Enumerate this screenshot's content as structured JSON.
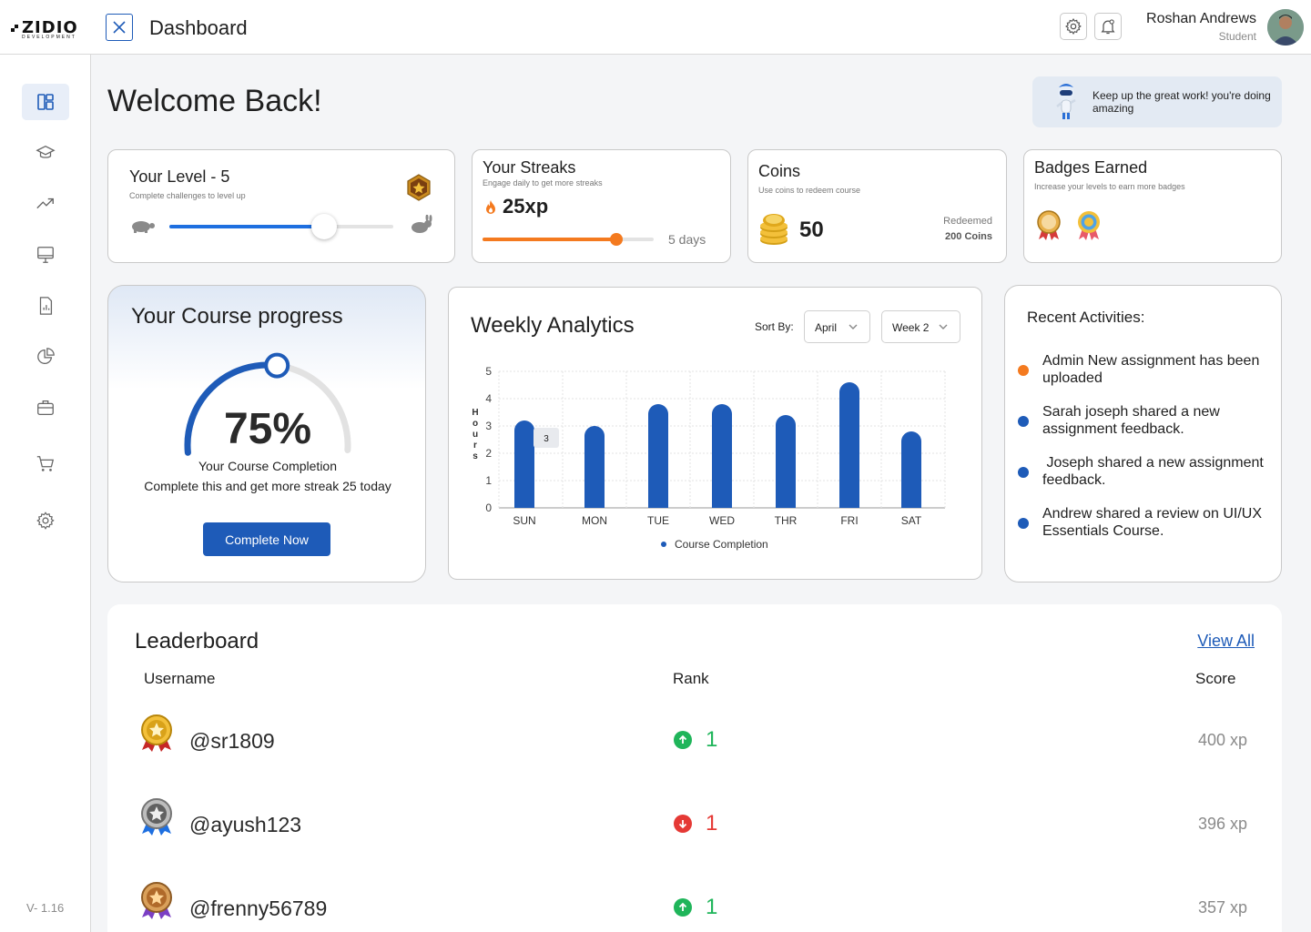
{
  "header": {
    "logo_text": "ZIDIO",
    "logo_sub": "DEVELOPMENT",
    "title": "Dashboard",
    "user_name": "Roshan Andrews",
    "user_role": "Student"
  },
  "sidebar": {
    "items": [
      "dashboard",
      "courses",
      "analytics",
      "classroom",
      "reports",
      "statistics",
      "portfolio",
      "cart",
      "settings"
    ],
    "version": "V- 1.16"
  },
  "welcome": {
    "title": "Welcome Back!",
    "toast": "Keep up the great work! you're doing amazing"
  },
  "level": {
    "title": "Your Level - 5",
    "subtitle": "Complete challenges to level up",
    "progress": 0.69
  },
  "streaks": {
    "title": "Your Streaks",
    "subtitle": "Engage daily to get more streaks",
    "xp": "25xp",
    "days": "5 days",
    "progress": 0.78
  },
  "coins": {
    "title": "Coins",
    "subtitle": "Use coins to redeem course",
    "value": "50",
    "redeemed_label": "Redeemed",
    "redeemed_value": "200 Coins"
  },
  "badges": {
    "title": "Badges Earned",
    "subtitle": "Increase your levels to earn more badges"
  },
  "course_progress": {
    "title": "Your Course progress",
    "percent": "75%",
    "value": 0.75,
    "label": "Your Course Completion",
    "description": "Complete this and get more streak 25 today",
    "button": "Complete Now"
  },
  "weekly": {
    "title": "Weekly Analytics",
    "sort_label": "Sort By:",
    "month": "April",
    "week": "Week 2",
    "y_label": "Hours",
    "legend": "Course Completion",
    "tooltip": "3"
  },
  "chart_data": {
    "type": "bar",
    "categories": [
      "SUN",
      "MON",
      "TUE",
      "WED",
      "THR",
      "FRI",
      "SAT"
    ],
    "series": [
      {
        "name": "Course Completion",
        "values": [
          3.2,
          3.0,
          3.8,
          3.8,
          3.4,
          4.6,
          2.8
        ]
      }
    ],
    "ylabel": "Hours",
    "ylim": [
      0,
      5
    ],
    "yticks": [
      0,
      1,
      2,
      3,
      4,
      5
    ],
    "grid": true,
    "legend": "bottom",
    "bar_color": "#1e5bb8"
  },
  "recent": {
    "title": "Recent Activities:",
    "items": [
      {
        "text": "Admin New assignment has been uploaded",
        "color": "#f47a1f"
      },
      {
        "text": "Sarah joseph shared a new assignment feedback.",
        "color": "#1e5bb8"
      },
      {
        "text": " Joseph shared a new assignment feedback.",
        "color": "#1e5bb8"
      },
      {
        "text": "Andrew shared a review on UI/UX Essentials Course.",
        "color": "#1e5bb8"
      }
    ]
  },
  "leaderboard": {
    "title": "Leaderboard",
    "view_all": "View All",
    "col_user": "Username",
    "col_rank": "Rank",
    "col_score": "Score",
    "rows": [
      {
        "user": "@sr1809",
        "rank": "1",
        "direction": "up",
        "score": "400 xp",
        "medal": "gold"
      },
      {
        "user": "@ayush123",
        "rank": "1",
        "direction": "down",
        "score": "396 xp",
        "medal": "silver"
      },
      {
        "user": "@frenny56789",
        "rank": "1",
        "direction": "up",
        "score": "357 xp",
        "medal": "bronze"
      }
    ]
  },
  "colors": {
    "primary": "#1e5bb8",
    "orange": "#f47a1f",
    "up": "#1fb55a",
    "down": "#e53935"
  }
}
